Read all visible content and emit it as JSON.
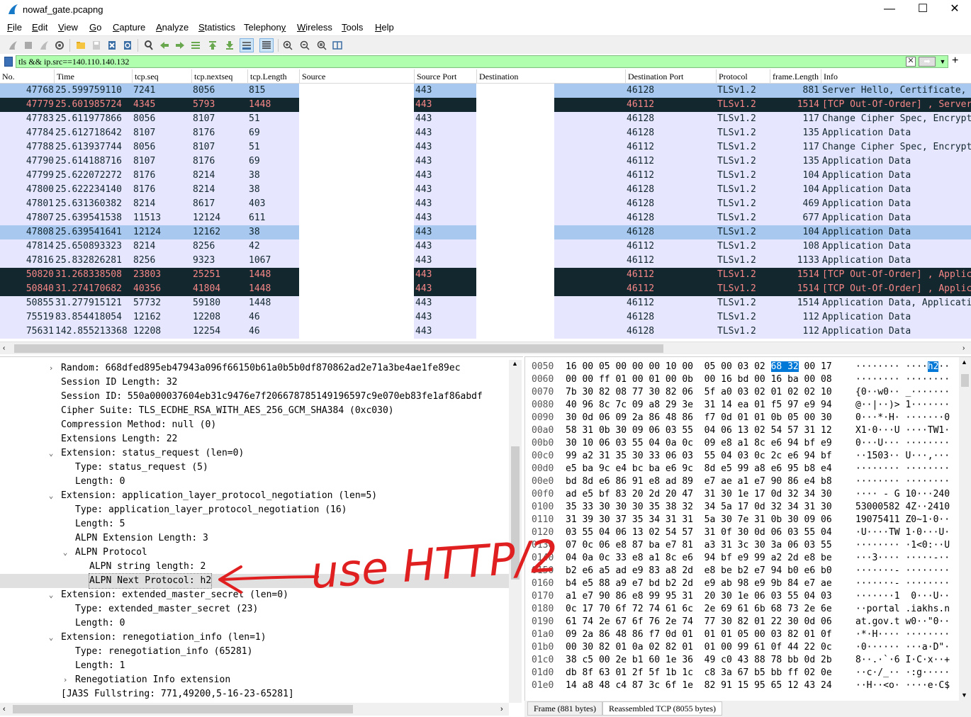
{
  "window": {
    "title": "nowaf_gate.pcapng",
    "minimize": "—",
    "maximize": "☐",
    "close": "✕"
  },
  "menu": [
    {
      "label": "File",
      "mn": "F"
    },
    {
      "label": "Edit",
      "mn": "E"
    },
    {
      "label": "View",
      "mn": "V"
    },
    {
      "label": "Go",
      "mn": "G"
    },
    {
      "label": "Capture",
      "mn": "C"
    },
    {
      "label": "Analyze",
      "mn": "A"
    },
    {
      "label": "Statistics",
      "mn": "S"
    },
    {
      "label": "Telephony",
      "mn": "y"
    },
    {
      "label": "Wireless",
      "mn": "W"
    },
    {
      "label": "Tools",
      "mn": "T"
    },
    {
      "label": "Help",
      "mn": "H"
    }
  ],
  "filter": {
    "value": "tls && ip.src==140.110.140.132"
  },
  "packet_list": {
    "columns": [
      "No.",
      "Time",
      "tcp.seq",
      "tcp.nextseq",
      "tcp.Length",
      "Source",
      "Source Port",
      "Destination",
      "Destination Port",
      "Protocol",
      "frame.Length",
      "Info"
    ],
    "rows": [
      {
        "no": "47768",
        "time": "25.599759110",
        "seq": "7241",
        "nextseq": "8056",
        "len": "815",
        "sport": "443",
        "dport": "46128",
        "proto": "TLSv1.2",
        "flen": "881",
        "info": "Server Hello, Certificate, Server",
        "style": "sel"
      },
      {
        "no": "47779",
        "time": "25.601985724",
        "seq": "4345",
        "nextseq": "5793",
        "len": "1448",
        "sport": "443",
        "dport": "46112",
        "proto": "TLSv1.2",
        "flen": "1514",
        "info": "[TCP Out-Of-Order] , Server Hello",
        "style": "bad"
      },
      {
        "no": "47783",
        "time": "25.611977866",
        "seq": "8056",
        "nextseq": "8107",
        "len": "51",
        "sport": "443",
        "dport": "46128",
        "proto": "TLSv1.2",
        "flen": "117",
        "info": "Change Cipher Spec, Encrypted",
        "style": "normal"
      },
      {
        "no": "47784",
        "time": "25.612718642",
        "seq": "8107",
        "nextseq": "8176",
        "len": "69",
        "sport": "443",
        "dport": "46128",
        "proto": "TLSv1.2",
        "flen": "135",
        "info": "Application Data",
        "style": "normal"
      },
      {
        "no": "47788",
        "time": "25.613937744",
        "seq": "8056",
        "nextseq": "8107",
        "len": "51",
        "sport": "443",
        "dport": "46112",
        "proto": "TLSv1.2",
        "flen": "117",
        "info": "Change Cipher Spec, Encrypted",
        "style": "normal"
      },
      {
        "no": "47790",
        "time": "25.614188716",
        "seq": "8107",
        "nextseq": "8176",
        "len": "69",
        "sport": "443",
        "dport": "46112",
        "proto": "TLSv1.2",
        "flen": "135",
        "info": "Application Data",
        "style": "normal"
      },
      {
        "no": "47799",
        "time": "25.622072272",
        "seq": "8176",
        "nextseq": "8214",
        "len": "38",
        "sport": "443",
        "dport": "46112",
        "proto": "TLSv1.2",
        "flen": "104",
        "info": "Application Data",
        "style": "normal"
      },
      {
        "no": "47800",
        "time": "25.622234140",
        "seq": "8176",
        "nextseq": "8214",
        "len": "38",
        "sport": "443",
        "dport": "46128",
        "proto": "TLSv1.2",
        "flen": "104",
        "info": "Application Data",
        "style": "normal"
      },
      {
        "no": "47801",
        "time": "25.631360382",
        "seq": "8214",
        "nextseq": "8617",
        "len": "403",
        "sport": "443",
        "dport": "46128",
        "proto": "TLSv1.2",
        "flen": "469",
        "info": "Application Data",
        "style": "normal"
      },
      {
        "no": "47807",
        "time": "25.639541538",
        "seq": "11513",
        "nextseq": "12124",
        "len": "611",
        "sport": "443",
        "dport": "46128",
        "proto": "TLSv1.2",
        "flen": "677",
        "info": "Application Data",
        "style": "normal"
      },
      {
        "no": "47808",
        "time": "25.639541641",
        "seq": "12124",
        "nextseq": "12162",
        "len": "38",
        "sport": "443",
        "dport": "46128",
        "proto": "TLSv1.2",
        "flen": "104",
        "info": "Application Data",
        "style": "sel"
      },
      {
        "no": "47814",
        "time": "25.650893323",
        "seq": "8214",
        "nextseq": "8256",
        "len": "42",
        "sport": "443",
        "dport": "46112",
        "proto": "TLSv1.2",
        "flen": "108",
        "info": "Application Data",
        "style": "normal"
      },
      {
        "no": "47816",
        "time": "25.832826281",
        "seq": "8256",
        "nextseq": "9323",
        "len": "1067",
        "sport": "443",
        "dport": "46112",
        "proto": "TLSv1.2",
        "flen": "1133",
        "info": "Application Data",
        "style": "normal"
      },
      {
        "no": "50820",
        "time": "31.268338508",
        "seq": "23803",
        "nextseq": "25251",
        "len": "1448",
        "sport": "443",
        "dport": "46112",
        "proto": "TLSv1.2",
        "flen": "1514",
        "info": "[TCP Out-Of-Order] , Application",
        "style": "bad"
      },
      {
        "no": "50840",
        "time": "31.274170682",
        "seq": "40356",
        "nextseq": "41804",
        "len": "1448",
        "sport": "443",
        "dport": "46112",
        "proto": "TLSv1.2",
        "flen": "1514",
        "info": "[TCP Out-Of-Order] , Application",
        "style": "bad"
      },
      {
        "no": "50855",
        "time": "31.277915121",
        "seq": "57732",
        "nextseq": "59180",
        "len": "1448",
        "sport": "443",
        "dport": "46112",
        "proto": "TLSv1.2",
        "flen": "1514",
        "info": "Application Data, Application",
        "style": "normal"
      },
      {
        "no": "75519",
        "time": "83.854418054",
        "seq": "12162",
        "nextseq": "12208",
        "len": "46",
        "sport": "443",
        "dport": "46128",
        "proto": "TLSv1.2",
        "flen": "112",
        "info": "Application Data",
        "style": "normal"
      },
      {
        "no": "75631",
        "time": "142.855213368",
        "seq": "12208",
        "nextseq": "12254",
        "len": "46",
        "sport": "443",
        "dport": "46128",
        "proto": "TLSv1.2",
        "flen": "112",
        "info": "Application Data",
        "style": "normal"
      }
    ]
  },
  "details": [
    {
      "indent": 0,
      "toggle": "closed",
      "text": "Random: 668dfed895eb47943a096f66150b61a0b5b0df870862ad2e71a3be4ae1fe89ec"
    },
    {
      "indent": 0,
      "toggle": "",
      "text": "Session ID Length: 32"
    },
    {
      "indent": 0,
      "toggle": "",
      "text": "Session ID: 550a000037604eb31c9476e7f206678785149196597c9e070eb83fe1af86abdf"
    },
    {
      "indent": 0,
      "toggle": "",
      "text": "Cipher Suite: TLS_ECDHE_RSA_WITH_AES_256_GCM_SHA384 (0xc030)"
    },
    {
      "indent": 0,
      "toggle": "",
      "text": "Compression Method: null (0)"
    },
    {
      "indent": 0,
      "toggle": "",
      "text": "Extensions Length: 22"
    },
    {
      "indent": 0,
      "toggle": "open",
      "text": "Extension: status_request (len=0)"
    },
    {
      "indent": 1,
      "toggle": "",
      "text": "Type: status_request (5)"
    },
    {
      "indent": 1,
      "toggle": "",
      "text": "Length: 0"
    },
    {
      "indent": 0,
      "toggle": "open",
      "text": "Extension: application_layer_protocol_negotiation (len=5)"
    },
    {
      "indent": 1,
      "toggle": "",
      "text": "Type: application_layer_protocol_negotiation (16)"
    },
    {
      "indent": 1,
      "toggle": "",
      "text": "Length: 5"
    },
    {
      "indent": 1,
      "toggle": "",
      "text": "ALPN Extension Length: 3"
    },
    {
      "indent": 1,
      "toggle": "open",
      "text": "ALPN Protocol"
    },
    {
      "indent": 2,
      "toggle": "",
      "text": "ALPN string length: 2"
    },
    {
      "indent": 2,
      "toggle": "",
      "text": "ALPN Next Protocol: h2",
      "selected": true
    },
    {
      "indent": 0,
      "toggle": "open",
      "text": "Extension: extended_master_secret (len=0)"
    },
    {
      "indent": 1,
      "toggle": "",
      "text": "Type: extended_master_secret (23)"
    },
    {
      "indent": 1,
      "toggle": "",
      "text": "Length: 0"
    },
    {
      "indent": 0,
      "toggle": "open",
      "text": "Extension: renegotiation_info (len=1)"
    },
    {
      "indent": 1,
      "toggle": "",
      "text": "Type: renegotiation_info (65281)"
    },
    {
      "indent": 1,
      "toggle": "",
      "text": "Length: 1"
    },
    {
      "indent": 1,
      "toggle": "closed",
      "text": "Renegotiation Info extension"
    },
    {
      "indent": 0,
      "toggle": "",
      "text": "[JA3S Fullstring: 771,49200,5-16-23-65281]"
    }
  ],
  "bytes": [
    {
      "off": "0050",
      "hex": "16 00 05 00 00 00 10 00  05 00 03 02 68 32 00 17",
      "ascii": "········ ····h2··"
    },
    {
      "off": "0060",
      "hex": "00 00 ff 01 00 01 00 0b  00 16 bd 00 16 ba 00 08",
      "ascii": "········ ········"
    },
    {
      "off": "0070",
      "hex": "7b 30 82 08 77 30 82 06  5f a0 03 02 01 02 02 10",
      "ascii": "{0··w0·· _·······"
    },
    {
      "off": "0080",
      "hex": "40 96 8c 7c 09 a8 29 3e  31 14 ea 01 f5 97 e9 94",
      "ascii": "@··|··)> 1·······"
    },
    {
      "off": "0090",
      "hex": "30 0d 06 09 2a 86 48 86  f7 0d 01 01 0b 05 00 30",
      "ascii": "0···*·H· ·······0"
    },
    {
      "off": "00a0",
      "hex": "58 31 0b 30 09 06 03 55  04 06 13 02 54 57 31 12",
      "ascii": "X1·0···U ····TW1·"
    },
    {
      "off": "00b0",
      "hex": "30 10 06 03 55 04 0a 0c  09 e8 a1 8c e6 94 bf e9",
      "ascii": "0···U··· ········"
    },
    {
      "off": "00c0",
      "hex": "99 a2 31 35 30 33 06 03  55 04 03 0c 2c e6 94 bf",
      "ascii": "··1503·· U···,···"
    },
    {
      "off": "00d0",
      "hex": "e5 ba 9c e4 bc ba e6 9c  8d e5 99 a8 e6 95 b8 e4",
      "ascii": "········ ········"
    },
    {
      "off": "00e0",
      "hex": "bd 8d e6 86 91 e8 ad 89  e7 ae a1 e7 90 86 e4 b8",
      "ascii": "········ ········"
    },
    {
      "off": "00f0",
      "hex": "ad e5 bf 83 20 2d 20 47  31 30 1e 17 0d 32 34 30",
      "ascii": "···· - G 10···240"
    },
    {
      "off": "0100",
      "hex": "35 33 30 30 30 35 38 32  34 5a 17 0d 32 34 31 30",
      "ascii": "53000582 4Z··2410"
    },
    {
      "off": "0110",
      "hex": "31 39 30 37 35 34 31 31  5a 30 7e 31 0b 30 09 06",
      "ascii": "19075411 Z0~1·0··"
    },
    {
      "off": "0120",
      "hex": "03 55 04 06 13 02 54 57  31 0f 30 0d 06 03 55 04",
      "ascii": "·U····TW 1·0···U·"
    },
    {
      "off": "0130",
      "hex": "07 0c 06 e8 87 ba e7 81  a3 31 3c 30 3a 06 03 55",
      "ascii": "········ ·1<0:··U"
    },
    {
      "off": "0140",
      "hex": "04 0a 0c 33 e8 a1 8c e6  94 bf e9 99 a2 2d e8 be",
      "ascii": "···3···· ·····-··"
    },
    {
      "off": "0150",
      "hex": "b2 e6 a5 ad e9 83 a8 2d  e8 be b2 e7 94 b0 e6 b0",
      "ascii": "·······- ········"
    },
    {
      "off": "0160",
      "hex": "b4 e5 88 a9 e7 bd b2 2d  e9 ab 98 e9 9b 84 e7 ae",
      "ascii": "·······- ········"
    },
    {
      "off": "0170",
      "hex": "a1 e7 90 86 e8 99 95 31  20 30 1e 06 03 55 04 03",
      "ascii": "·······1  0···U··"
    },
    {
      "off": "0180",
      "hex": "0c 17 70 6f 72 74 61 6c  2e 69 61 6b 68 73 2e 6e",
      "ascii": "··portal .iakhs.n"
    },
    {
      "off": "0190",
      "hex": "61 74 2e 67 6f 76 2e 74  77 30 82 01 22 30 0d 06",
      "ascii": "at.gov.t w0··\"0··"
    },
    {
      "off": "01a0",
      "hex": "09 2a 86 48 86 f7 0d 01  01 01 05 00 03 82 01 0f",
      "ascii": "·*·H···· ········"
    },
    {
      "off": "01b0",
      "hex": "00 30 82 01 0a 02 82 01  01 00 99 61 0f 44 22 0c",
      "ascii": "·0······ ···a·D\"·"
    },
    {
      "off": "01c0",
      "hex": "38 c5 00 2e b1 60 1e 36  49 c0 43 88 78 bb 0d 2b",
      "ascii": "8··.·`·6 I·C·x··+"
    },
    {
      "off": "01d0",
      "hex": "db 8f 63 01 2f 5f 1b 1c  c8 3a 67 b5 bb ff 02 0e",
      "ascii": "··c·/_·· ·:g·····"
    },
    {
      "off": "01e0",
      "hex": "14 a8 48 c4 87 3c 6f 1e  82 91 15 95 65 12 43 24",
      "ascii": "··H··<o· ····e·C$"
    }
  ],
  "bytes_tabs": [
    "Frame (881 bytes)",
    "Reassembled TCP (8055 bytes)"
  ],
  "annotation": {
    "text": "use HTTP/2",
    "color": "#e02020"
  },
  "colors": {
    "row_normal_bg": "#e7e6ff",
    "row_selected_bg": "#a8c8f0",
    "row_bad_bg": "#12272e",
    "row_bad_fg": "#f78787",
    "filter_bg": "#afffaf",
    "byte_highlight": "#0078d7"
  }
}
